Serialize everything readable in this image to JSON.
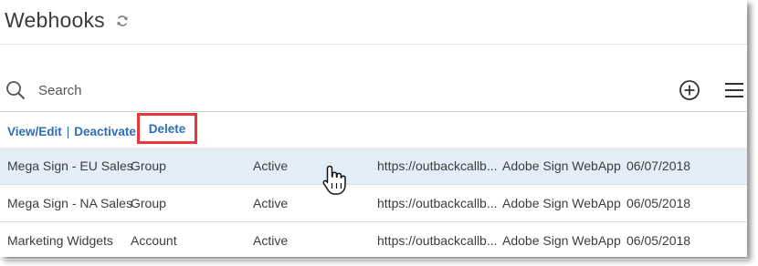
{
  "header": {
    "title": "Webhooks",
    "refresh_icon": "refresh-icon"
  },
  "search": {
    "placeholder": "Search"
  },
  "toolbar": {
    "add_icon": "plus-circle-icon",
    "menu_icon": "hamburger-menu-icon"
  },
  "actions": {
    "view_edit": "View/Edit",
    "separator": "|",
    "deactivate": "Deactivate",
    "delete": "Delete",
    "highlight_color": "#e8373b"
  },
  "rows": [
    {
      "name": "Mega Sign - EU Sales",
      "scope": "Group",
      "status": "Active",
      "url": "https://outbackcallb...",
      "application": "Adobe Sign WebApp",
      "date": "06/07/2018",
      "selected": true
    },
    {
      "name": "Mega Sign - NA Sales",
      "scope": "Group",
      "status": "Active",
      "url": "https://outbackcallb...",
      "application": "Adobe Sign WebApp",
      "date": "06/05/2018",
      "selected": false
    },
    {
      "name": "Marketing Widgets",
      "scope": "Account",
      "status": "Active",
      "url": "https://outbackcallb...",
      "application": "Adobe Sign WebApp",
      "date": "06/05/2018",
      "selected": false
    }
  ],
  "colors": {
    "link": "#2c6fb7",
    "selected_row": "#e4eef8"
  }
}
